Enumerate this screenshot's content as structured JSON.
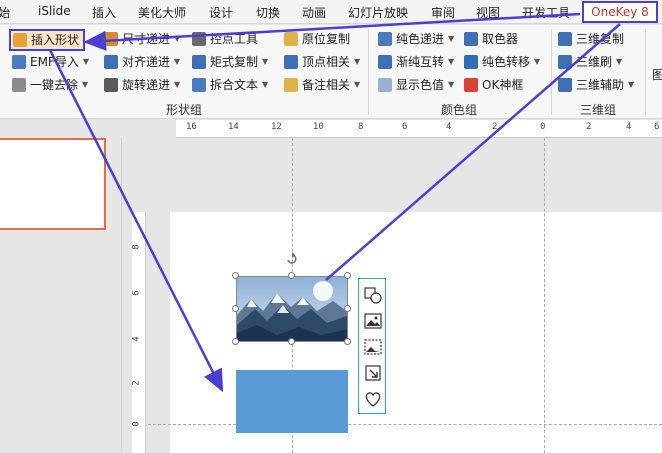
{
  "menubar": {
    "tabs": [
      "开始",
      "iSlide",
      "插入",
      "美化大师",
      "设计",
      "切换",
      "动画",
      "幻灯片放映",
      "审阅",
      "视图",
      "开发工具",
      "OneKey 8"
    ],
    "visible_first_tab": "始"
  },
  "ribbon": {
    "shape_group": {
      "label": "形状组",
      "buttons": [
        "插入形状",
        "EMF导入",
        "一键去除",
        "尺寸递进",
        "对齐递进",
        "旋转递进",
        "控点工具",
        "矩式复制",
        "拆合文本",
        "原位复制",
        "顶点相关",
        "备注相关"
      ]
    },
    "color_group": {
      "label": "颜色组",
      "buttons": [
        "纯色递进",
        "渐纯互转",
        "显示色值",
        "取色器",
        "纯色转移",
        "OK神框"
      ]
    },
    "threed_group": {
      "label": "三维组",
      "buttons": [
        "三维复制",
        "三维刷",
        "三维辅助"
      ]
    },
    "partial_label": "图"
  },
  "ruler": {
    "h_ticks": [
      "16",
      "14",
      "12",
      "10",
      "8",
      "6",
      "4",
      "2",
      "0",
      "2",
      "4",
      "6"
    ],
    "v_ticks": [
      "8",
      "6",
      "4",
      "2",
      "0"
    ]
  },
  "colors": {
    "accent_onekey": "#c0392b",
    "annotation_border": "#4a3fd1",
    "rect_fill": "#5b9bd5",
    "thumb_border": "#e06c4c",
    "toolbar_border": "#2aa6c8"
  },
  "float_toolbar": {
    "icons": [
      "shape-icon",
      "image-icon",
      "crop-image-icon",
      "resize-icon",
      "heart-icon"
    ]
  }
}
